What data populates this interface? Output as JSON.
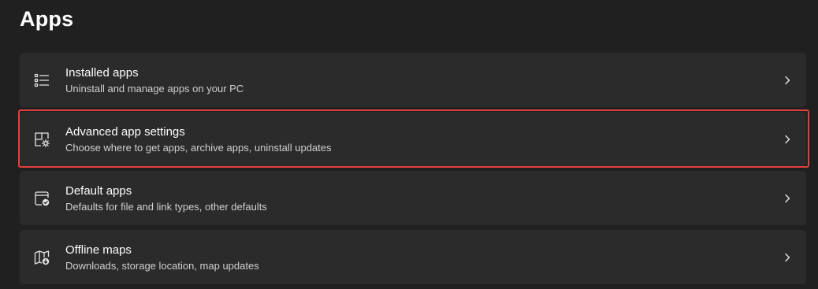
{
  "page": {
    "title": "Apps"
  },
  "items": [
    {
      "title": "Installed apps",
      "description": "Uninstall and manage apps on your PC",
      "icon": "installed-apps-list-icon"
    },
    {
      "title": "Advanced app settings",
      "description": "Choose where to get apps, archive apps, uninstall updates",
      "icon": "advanced-app-settings-icon",
      "highlighted": true
    },
    {
      "title": "Default apps",
      "description": "Defaults for file and link types, other defaults",
      "icon": "default-apps-icon"
    },
    {
      "title": "Offline maps",
      "description": "Downloads, storage location, map updates",
      "icon": "offline-maps-icon"
    }
  ],
  "colors": {
    "background": "#202020",
    "card": "#2b2b2b",
    "highlight": "#e0403f",
    "secondary_text": "#cfcfcf"
  }
}
